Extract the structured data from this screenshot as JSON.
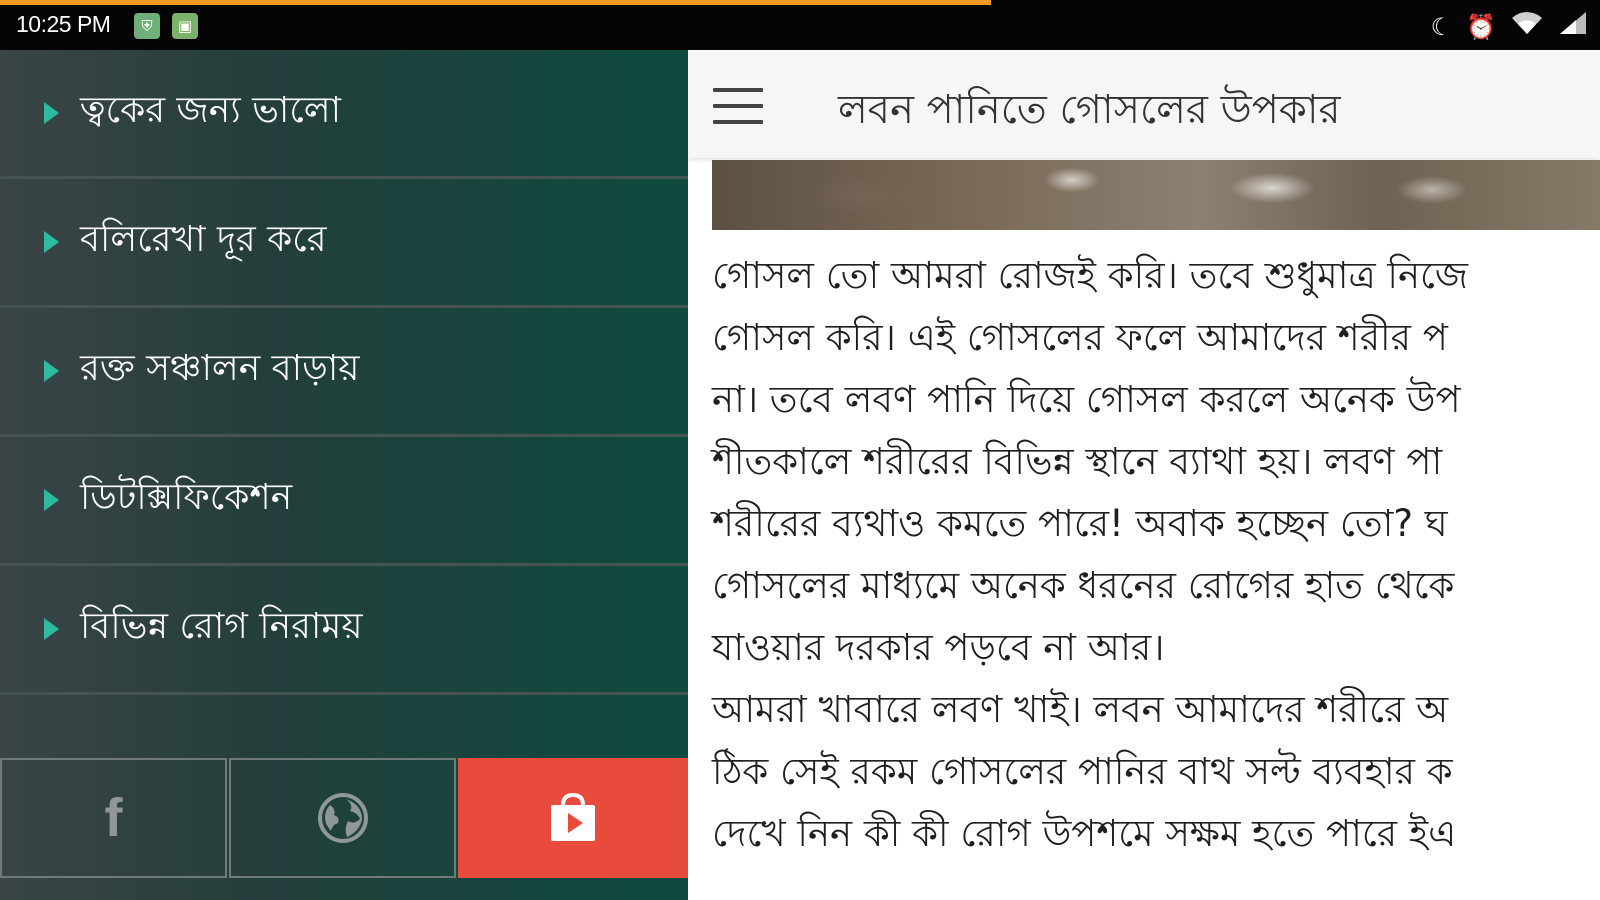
{
  "status_bar": {
    "time": "10:25 PM",
    "notification_icons": [
      "shield-notification-icon",
      "android-notification-icon"
    ],
    "system_icons": [
      "moon-icon",
      "alarm-icon",
      "wifi-icon",
      "signal-icon"
    ],
    "loading_color": "#f39a24"
  },
  "drawer": {
    "items": [
      {
        "label": "ত্বকের জন্য ভালো"
      },
      {
        "label": "বলিরেখা দূর করে"
      },
      {
        "label": "রক্ত সঞ্চালন বাড়ায়"
      },
      {
        "label": "ডিটক্সিফিকেশন"
      },
      {
        "label": "বিভিন্ন রোগ নিরাময়"
      }
    ],
    "footer_buttons": [
      {
        "icon": "facebook-icon",
        "glyph": "f"
      },
      {
        "icon": "globe-icon"
      },
      {
        "icon": "play-store-bag-icon",
        "active_color": "#e84a3c"
      }
    ],
    "arrow_color": "#2bbca0"
  },
  "appbar": {
    "title": "লবন পানিতে গোসলের উপকার",
    "menu_icon": "hamburger-menu-icon"
  },
  "article": {
    "lines": [
      "গোসল তো আমরা রোজই করি। তবে শুধুমাত্র নিজে",
      "গোসল করি। এই গোসলের ফলে আমাদের শরীর প",
      "না। তবে লবণ পানি দিয়ে গোসল করলে অনেক উপ",
      "শীতকালে শরীরের বিভিন্ন স্থানে ব্যাথা হয়। লবণ পা",
      "শরীরের ব্যথাও কমতে পারে! অবাক হচ্ছেন তো? ঘ",
      "গোসলের মাধ্যমে অনেক ধরনের রোগের হাত থেকে",
      "যাওয়ার দরকার পড়বে না আর।",
      "আমরা খাবারে লবণ খাই। লবন আমাদের শরীরে অ",
      "ঠিক সেই রকম গোসলের পানির বাথ সল্ট ব্যবহার ক",
      "দেখে নিন কী কী রোগ উপশমে সক্ষম হতে পারে ইএ"
    ]
  }
}
